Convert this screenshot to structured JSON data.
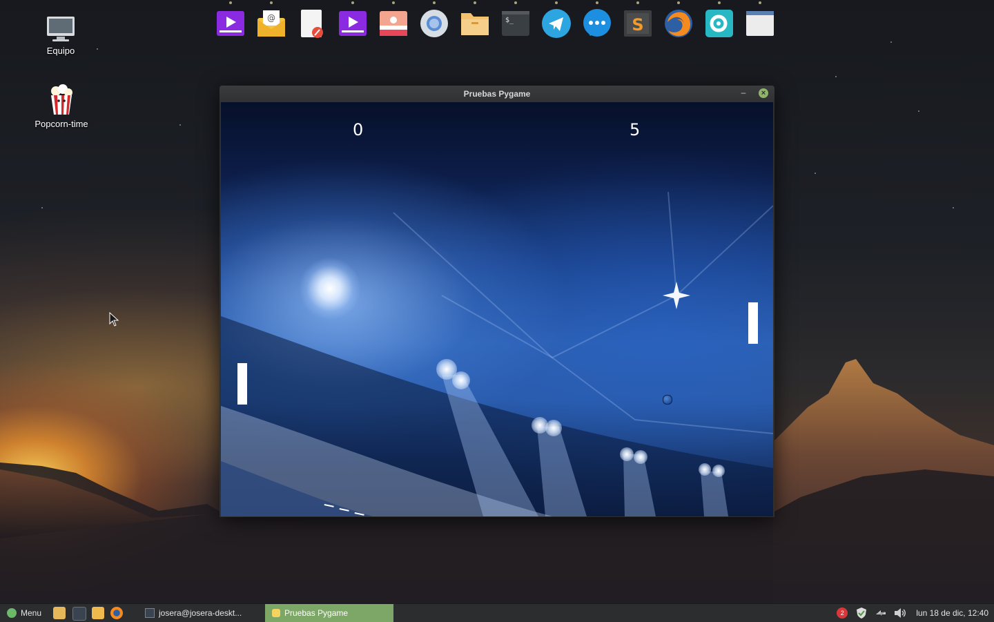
{
  "desktop": {
    "icons": [
      {
        "label": "Equipo",
        "icon": "computer-icon"
      },
      {
        "label": "Popcorn-time",
        "icon": "popcorn-icon"
      }
    ]
  },
  "dock": {
    "items": [
      {
        "icon": "video-player-icon",
        "color": "#8a2be2"
      },
      {
        "icon": "mail-icon",
        "color": "#f5c542"
      },
      {
        "icon": "text-editor-icon",
        "color": "#e84c3d"
      },
      {
        "icon": "media-player-icon",
        "color": "#8a2be2"
      },
      {
        "icon": "image-viewer-icon",
        "color": "#f36b5b"
      },
      {
        "icon": "chromium-icon",
        "color": "#5a8dd6"
      },
      {
        "icon": "files-icon",
        "color": "#f3c26e"
      },
      {
        "icon": "terminal-icon",
        "color": "#3a3f44"
      },
      {
        "icon": "telegram-icon",
        "color": "#2ca5e0"
      },
      {
        "icon": "messaging-icon",
        "color": "#1d8fe0"
      },
      {
        "icon": "sublime-text-icon",
        "color": "#f29b2a"
      },
      {
        "icon": "firefox-icon",
        "color": "#f58a1f"
      },
      {
        "icon": "settings-icon",
        "color": "#27b8c4"
      },
      {
        "icon": "window-icon",
        "color": "#e8e8e8"
      }
    ]
  },
  "window": {
    "title": "Pruebas Pygame",
    "minimize_label": "–",
    "close_label": "×"
  },
  "game": {
    "score_left": "0",
    "score_right": "5"
  },
  "taskbar": {
    "menu_label": "Menu",
    "launchers": [
      {
        "icon": "show-desktop-icon",
        "color": "#e6b85a"
      },
      {
        "icon": "terminal-icon",
        "color": "#3a4450"
      },
      {
        "icon": "files-icon",
        "color": "#f0b94e"
      },
      {
        "icon": "firefox-icon",
        "color": "#f58a1f"
      }
    ],
    "tasks": [
      {
        "label": "josera@josera-deskt...",
        "icon": "terminal-icon",
        "active": false
      },
      {
        "label": "Pruebas Pygame",
        "icon": "pygame-icon",
        "active": true
      }
    ],
    "tray": {
      "updates_badge": "2",
      "clock": "lun 18 de dic, 12:40",
      "icons": [
        "updates-icon",
        "shield-icon",
        "network-icon",
        "volume-icon"
      ]
    }
  }
}
